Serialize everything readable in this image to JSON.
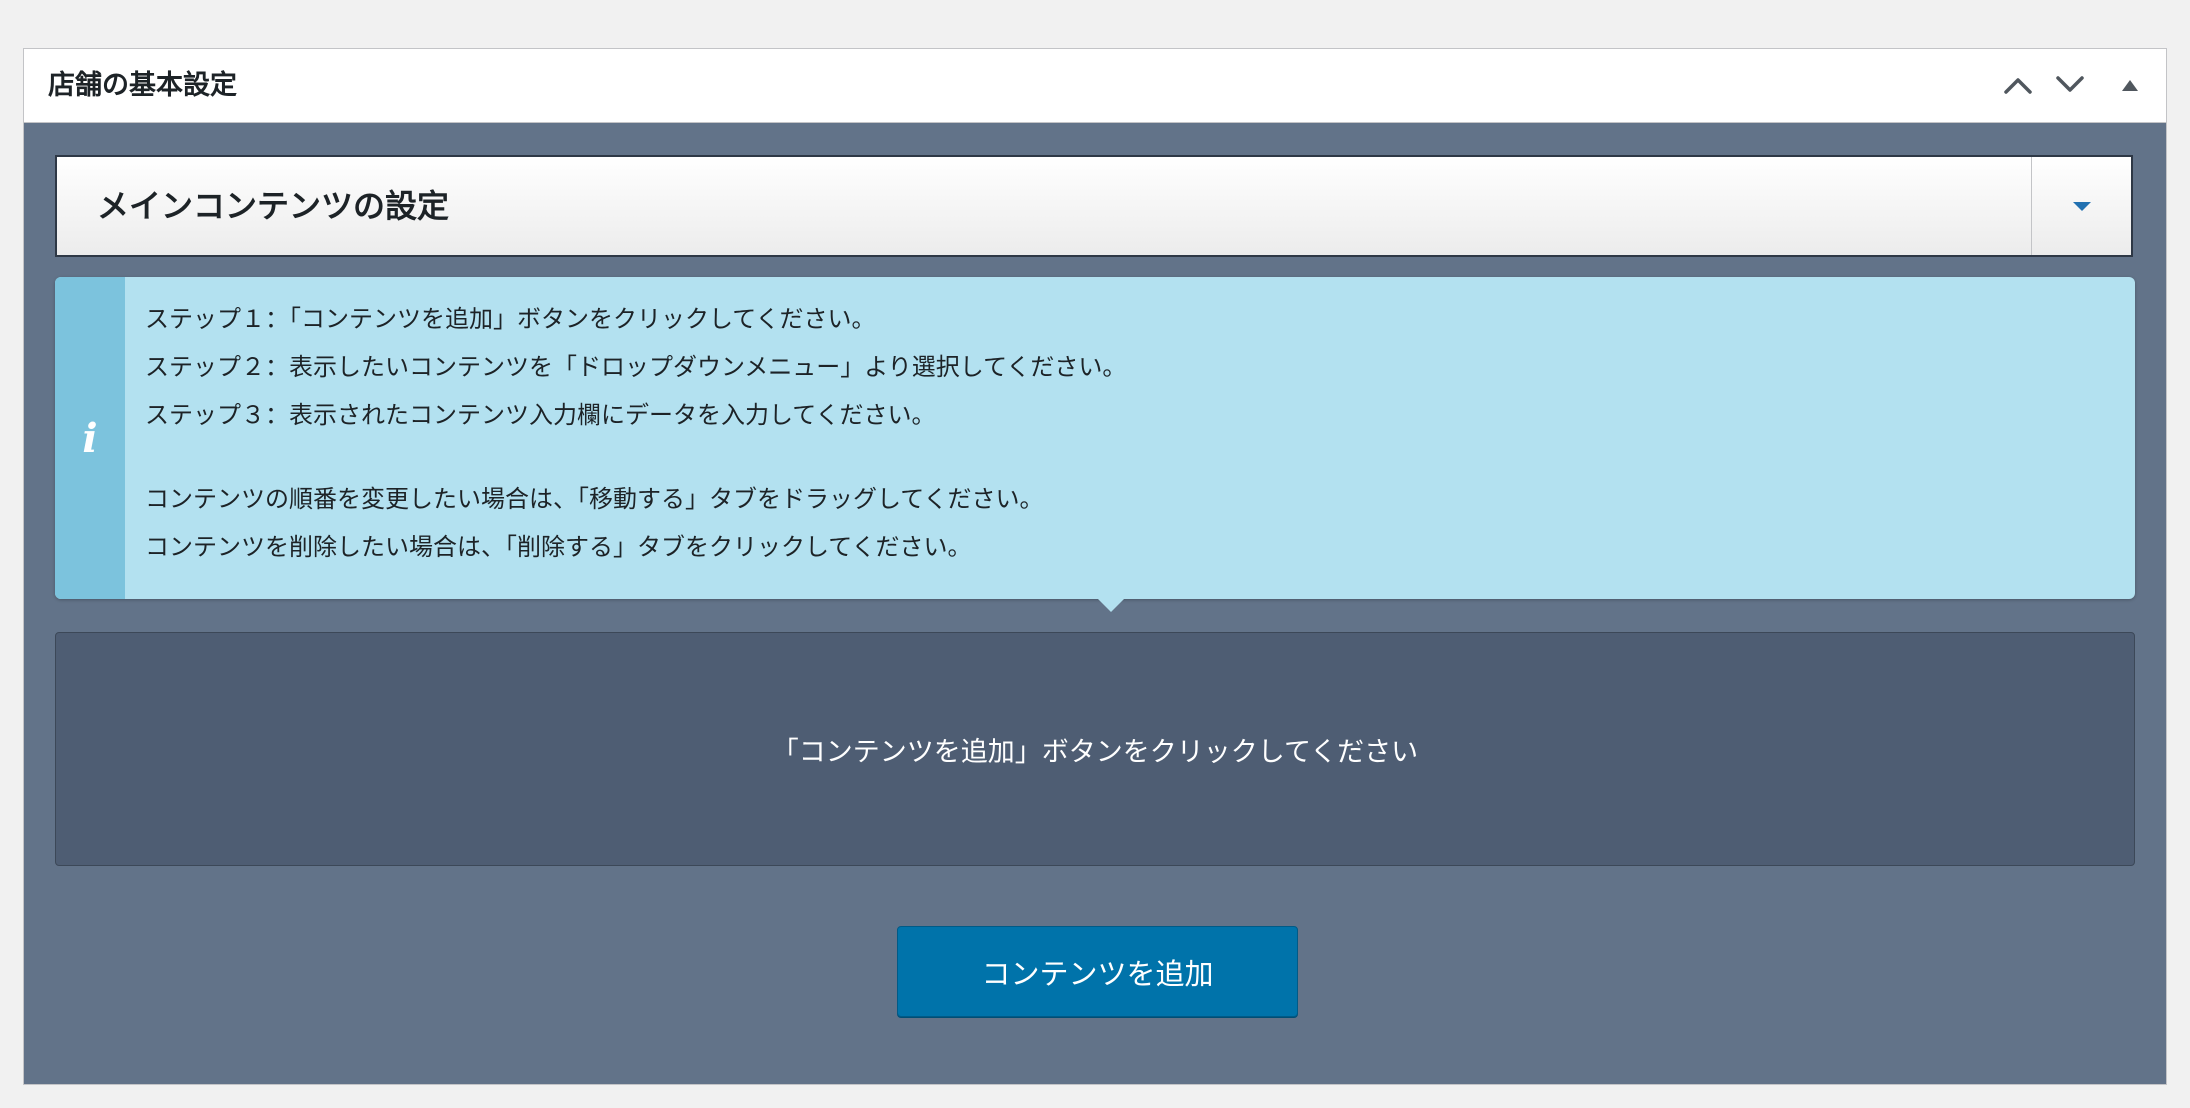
{
  "postbox": {
    "title": "店舗の基本設定",
    "controls": {
      "move_up_icon": "chevron-up-icon",
      "move_down_icon": "chevron-down-icon",
      "toggle_icon": "triangle-up-icon"
    }
  },
  "section": {
    "title": "メインコンテンツの設定",
    "toggle_icon": "triangle-down-icon"
  },
  "info": {
    "icon": "info-icon",
    "icon_glyph": "i",
    "steps": [
      "ステップ１：「コンテンツを追加」ボタンをクリックしてください。",
      "ステップ２：表示したいコンテンツを「ドロップダウンメニュー」より選択してください。",
      "ステップ３：表示されたコンテンツ入力欄にデータを入力してください。"
    ],
    "notes": [
      "コンテンツの順番を変更したい場合は、「移動する」タブをドラッグしてください。",
      "コンテンツを削除したい場合は、「削除する」タブをクリックしてください。"
    ]
  },
  "empty_state": {
    "message": "「コンテンツを追加」ボタンをクリックしてください"
  },
  "add_button": {
    "label": "コンテンツを追加"
  },
  "colors": {
    "page_bg": "#f1f1f1",
    "panel_bg": "#627389",
    "info_bg": "#b3e1f0",
    "info_side": "#7cc3dd",
    "empty_bg": "#4e5d73",
    "button_bg": "#0073aa",
    "toggle_accent": "#2271b1"
  }
}
